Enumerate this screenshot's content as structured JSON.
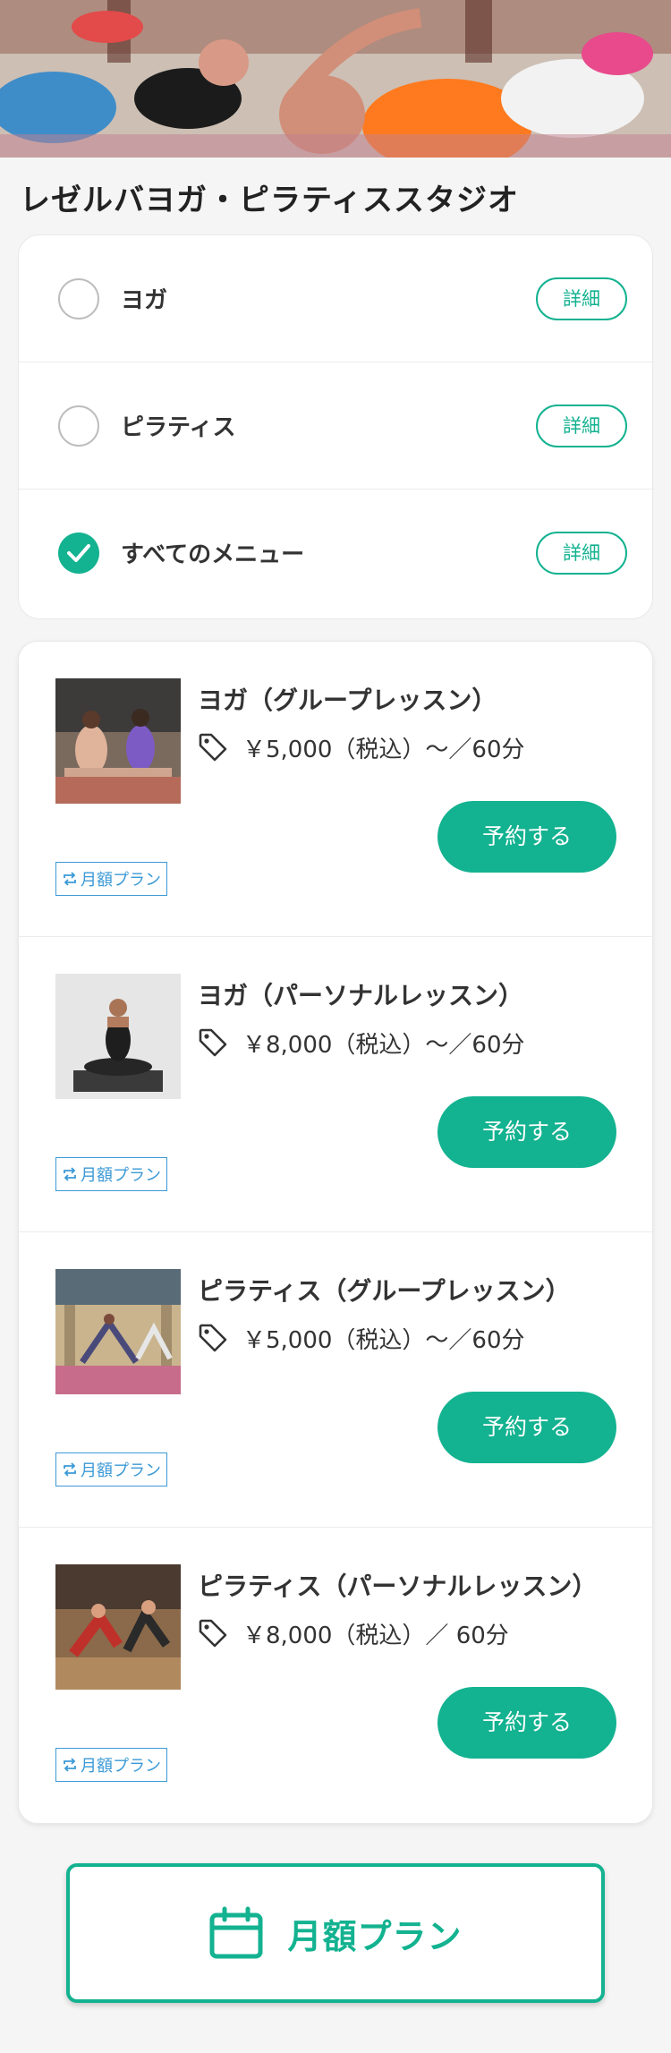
{
  "header": {
    "studio_name": "レゼルバヨガ・ピラティススタジオ"
  },
  "categories": [
    {
      "label": "ヨガ",
      "selected": false,
      "detail_label": "詳細"
    },
    {
      "label": "ピラティス",
      "selected": false,
      "detail_label": "詳細"
    },
    {
      "label": "すべてのメニュー",
      "selected": true,
      "detail_label": "詳細"
    }
  ],
  "lessons": [
    {
      "title": "ヨガ（グループレッスン）",
      "price": "￥5,000（税込）〜／60分",
      "reserve_label": "予約する",
      "plan_label": "月額プラン"
    },
    {
      "title": "ヨガ（パーソナルレッスン）",
      "price": "￥8,000（税込）〜／60分",
      "reserve_label": "予約する",
      "plan_label": "月額プラン"
    },
    {
      "title": "ピラティス（グループレッスン）",
      "price": "￥5,000（税込）〜／60分",
      "reserve_label": "予約する",
      "plan_label": "月額プラン"
    },
    {
      "title": "ピラティス（パーソナルレッスン）",
      "price": "￥8,000（税込）／ 60分",
      "reserve_label": "予約する",
      "plan_label": "月額プラン"
    }
  ],
  "footer": {
    "monthly_plan_label": "月額プラン"
  },
  "icons": {
    "radio_checked": "check-icon",
    "price": "tag-icon",
    "plan": "repeat-icon",
    "monthly": "calendar-icon"
  },
  "colors": {
    "accent": "#13b290",
    "plan_badge": "#3b99d6"
  }
}
